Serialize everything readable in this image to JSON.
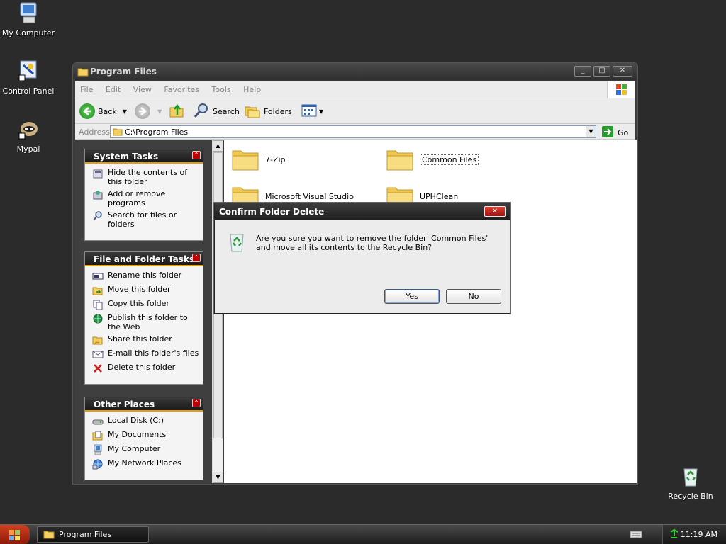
{
  "desktop": {
    "icons": [
      {
        "label": "My Computer",
        "icon": "my-computer-icon"
      },
      {
        "label": "Control Panel",
        "icon": "control-panel-icon"
      },
      {
        "label": "Mypal",
        "icon": "mypal-icon"
      },
      {
        "label": "Recycle Bin",
        "icon": "recycle-bin-icon"
      }
    ]
  },
  "window": {
    "title": "Program Files",
    "controls": {
      "minimize": "_",
      "maximize": "□",
      "close": "✕"
    },
    "menu": [
      "File",
      "Edit",
      "View",
      "Favorites",
      "Tools",
      "Help"
    ],
    "toolbar": {
      "back": "Back",
      "search": "Search",
      "folders": "Folders"
    },
    "address": {
      "label": "Address",
      "value": "C:\\Program Files",
      "go": "Go"
    },
    "panels": {
      "system_tasks": {
        "title": "System Tasks",
        "items": [
          {
            "label": "Hide the contents of this folder",
            "icon": "hide-icon"
          },
          {
            "label": "Add or remove programs",
            "icon": "add-remove-icon"
          },
          {
            "label": "Search for files or folders",
            "icon": "search-icon"
          }
        ]
      },
      "file_folder_tasks": {
        "title": "File and Folder Tasks",
        "items": [
          {
            "label": "Rename this folder",
            "icon": "rename-icon"
          },
          {
            "label": "Move this folder",
            "icon": "move-icon"
          },
          {
            "label": "Copy this folder",
            "icon": "copy-icon"
          },
          {
            "label": "Publish this folder to the Web",
            "icon": "publish-web-icon"
          },
          {
            "label": "Share this folder",
            "icon": "share-icon"
          },
          {
            "label": "E-mail this folder's files",
            "icon": "email-icon"
          },
          {
            "label": "Delete this folder",
            "icon": "delete-icon"
          }
        ]
      },
      "other_places": {
        "title": "Other Places",
        "items": [
          {
            "label": "Local Disk (C:)",
            "icon": "local-disk-icon"
          },
          {
            "label": "My Documents",
            "icon": "my-documents-icon"
          },
          {
            "label": "My Computer",
            "icon": "my-computer-icon"
          },
          {
            "label": "My Network Places",
            "icon": "network-places-icon"
          }
        ]
      }
    },
    "folders": [
      "7-Zip",
      "Common Files",
      "Microsoft Visual Studio",
      "UPHClean"
    ]
  },
  "dialog": {
    "title": "Confirm Folder Delete",
    "message": "Are you sure you want to remove the folder 'Common Files' and move all its contents to the Recycle Bin?",
    "yes": "Yes",
    "no": "No",
    "close": "✕"
  },
  "taskbar": {
    "task": "Program Files",
    "clock": "11:19 AM"
  },
  "colors": {
    "desktop": "#2b2b2b",
    "accent": "#e8a000",
    "close_red": "#c02818"
  }
}
